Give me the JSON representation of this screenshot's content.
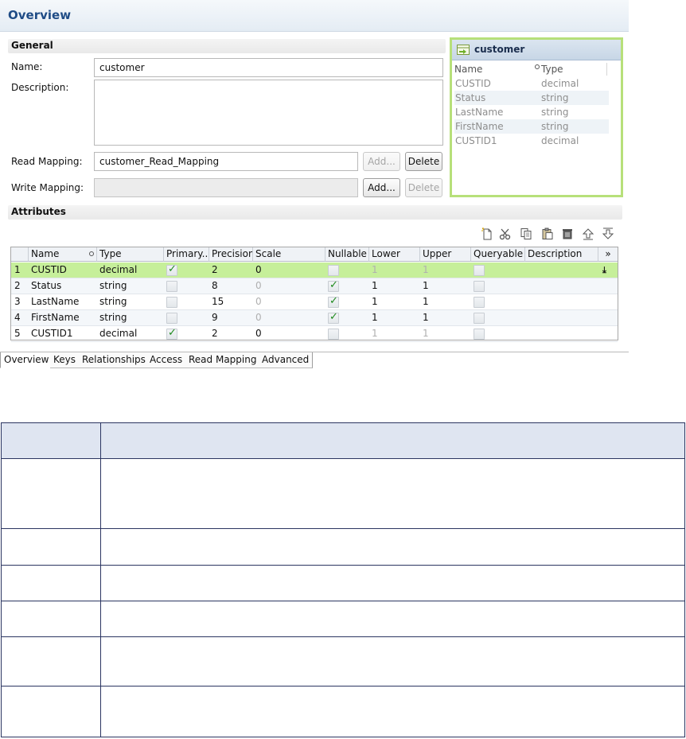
{
  "overview": {
    "title": "Overview"
  },
  "general": {
    "section_title": "General",
    "name_label": "Name:",
    "name_value": "customer",
    "description_label": "Description:",
    "description_value": "",
    "read_mapping_label": "Read Mapping:",
    "read_mapping_value": "customer_Read_Mapping",
    "write_mapping_label": "Write Mapping:",
    "write_mapping_value": "",
    "add_label": "Add...",
    "delete_label": "Delete"
  },
  "customer_panel": {
    "title": "customer",
    "col_name": "Name",
    "col_type": "Type",
    "rows": [
      {
        "name": "CUSTID",
        "type": "decimal"
      },
      {
        "name": "Status",
        "type": "string"
      },
      {
        "name": "LastName",
        "type": "string"
      },
      {
        "name": "FirstName",
        "type": "string"
      },
      {
        "name": "CUSTID1",
        "type": "decimal"
      }
    ]
  },
  "attributes": {
    "section_title": "Attributes",
    "toolbar_icons": [
      "new-icon",
      "cut-icon",
      "copy-icon",
      "paste-icon",
      "delete-icon",
      "move-up-icon",
      "move-down-icon"
    ],
    "columns": [
      "Name",
      "Type",
      "Primary...",
      "Precision",
      "Scale",
      "Nullable",
      "Lower",
      "Upper",
      "Queryable",
      "Description",
      "»"
    ],
    "rows": [
      {
        "num": "1",
        "name": "CUSTID",
        "type": "decimal",
        "primary": true,
        "precision": "2",
        "scale": "0",
        "scale_dim": false,
        "nullable": false,
        "lower": "1",
        "upper": "1",
        "bounds_dim": true,
        "queryable": false
      },
      {
        "num": "2",
        "name": "Status",
        "type": "string",
        "primary": false,
        "precision": "8",
        "scale": "0",
        "scale_dim": true,
        "nullable": true,
        "lower": "1",
        "upper": "1",
        "bounds_dim": false,
        "queryable": false
      },
      {
        "num": "3",
        "name": "LastName",
        "type": "string",
        "primary": false,
        "precision": "15",
        "scale": "0",
        "scale_dim": true,
        "nullable": true,
        "lower": "1",
        "upper": "1",
        "bounds_dim": false,
        "queryable": false
      },
      {
        "num": "4",
        "name": "FirstName",
        "type": "string",
        "primary": false,
        "precision": "9",
        "scale": "0",
        "scale_dim": true,
        "nullable": true,
        "lower": "1",
        "upper": "1",
        "bounds_dim": false,
        "queryable": false
      },
      {
        "num": "5",
        "name": "CUSTID1",
        "type": "decimal",
        "primary": true,
        "precision": "2",
        "scale": "0",
        "scale_dim": false,
        "nullable": false,
        "lower": "1",
        "upper": "1",
        "bounds_dim": true,
        "queryable": false
      }
    ]
  },
  "tabs": [
    "Overview",
    "Keys",
    "Relationships",
    "Access",
    "Read Mapping",
    "Advanced"
  ],
  "colors": {
    "accent": "#1f4c86",
    "selected_row": "#c6ef9a",
    "panel_border": "#b7e07a",
    "table_border": "#2b3561",
    "table_header": "#dfe5f1"
  }
}
